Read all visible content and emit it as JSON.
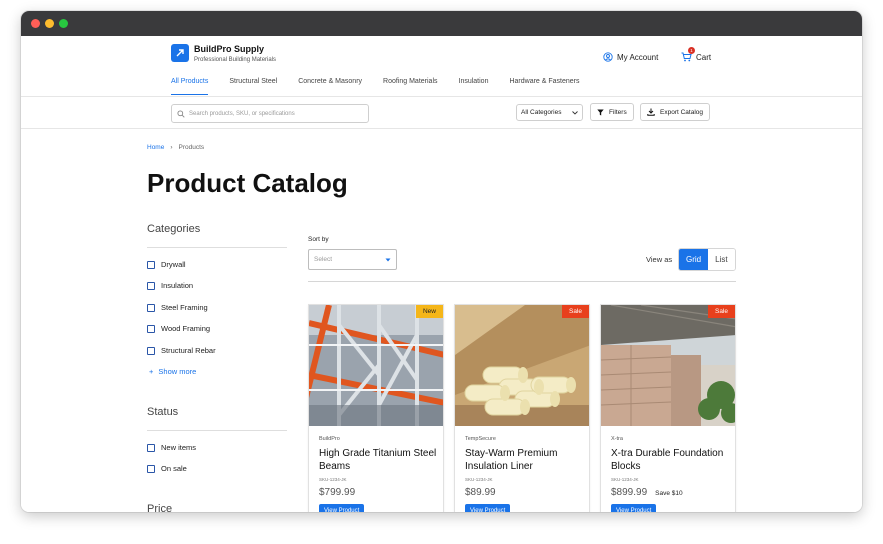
{
  "header": {
    "brand": "BuildPro Supply",
    "tagline": "Professional Building Materials",
    "account_label": "My Account",
    "cart_label": "Cart",
    "cart_count": "1"
  },
  "nav": {
    "items": [
      {
        "label": "All Products",
        "active": true
      },
      {
        "label": "Structural Steel"
      },
      {
        "label": "Concrete & Masonry"
      },
      {
        "label": "Roofing Materials"
      },
      {
        "label": "Insulation"
      },
      {
        "label": "Hardware & Fasteners"
      }
    ]
  },
  "toolbar": {
    "search_placeholder": "Search products, SKU, or specifications",
    "category_select": "All Categories",
    "filters_label": "Filters",
    "export_label": "Export Catalog"
  },
  "breadcrumb": {
    "home": "Home",
    "current": "Products"
  },
  "page": {
    "title": "Product Catalog"
  },
  "sidebar": {
    "categories_heading": "Categories",
    "categories": [
      "Drywall",
      "Insulation",
      "Steel Framing",
      "Wood Framing",
      "Structural Rebar"
    ],
    "show_more": "Show more",
    "status_heading": "Status",
    "status": [
      "New items",
      "On sale"
    ],
    "price_heading": "Price"
  },
  "listing": {
    "sort_label": "Sort by",
    "sort_placeholder": "Select",
    "view_as_label": "View as",
    "view_grid": "Grid",
    "view_list": "List"
  },
  "products": [
    {
      "brand": "BuildPro",
      "name": "High Grade Titanium Steel Beams",
      "sku": "SKU-1234-JK",
      "price": "$799.99",
      "badge": "New",
      "save": "",
      "button": "View Product"
    },
    {
      "brand": "TempSecure",
      "name": "Stay-Warm Premium Insulation Liner",
      "sku": "SKU-1234-JK",
      "price": "$89.99",
      "badge": "Sale",
      "save": "",
      "button": "View Product"
    },
    {
      "brand": "X-tra",
      "name": "X-tra Durable Foundation Blocks",
      "sku": "SKU-1234-JK",
      "price": "$899.99",
      "badge": "Sale",
      "save": "Save $10",
      "button": "View Product"
    }
  ],
  "colors": {
    "accent": "#1a73e8",
    "badge_new": "#f5b619",
    "badge_sale": "#e8401c"
  }
}
